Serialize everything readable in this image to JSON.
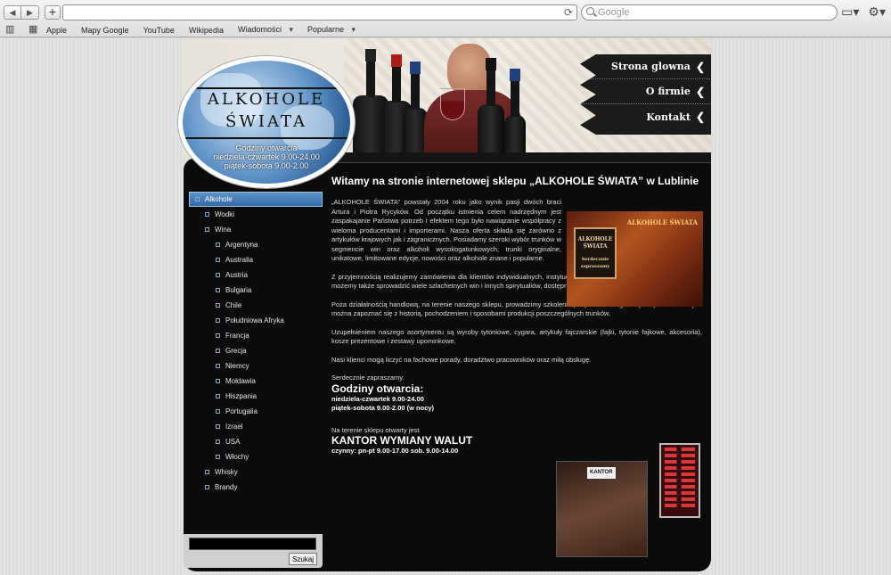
{
  "browser": {
    "back_glyph": "◀",
    "forward_glyph": "▶",
    "newtab_glyph": "+",
    "reload_glyph": "⟳",
    "search_placeholder": "Google",
    "bookmarks": [
      {
        "label": "Apple"
      },
      {
        "label": "Mapy Google"
      },
      {
        "label": "YouTube"
      },
      {
        "label": "Wikipedia"
      },
      {
        "label": "Wiadomości"
      },
      {
        "label": "Popularne"
      }
    ]
  },
  "header": {
    "logo_line1": "ALKOHOLE",
    "logo_line2": "ŚWIATA",
    "hours_title": "Godziny otwarcia",
    "hours_line1": "niedziela-czwartek 9.00-24.00",
    "hours_line2": "piątek-sobota 9.00-2.00"
  },
  "menu": [
    {
      "label": "Strona glowna"
    },
    {
      "label": "O firmie"
    },
    {
      "label": "Kontakt"
    }
  ],
  "sidebar": {
    "items": [
      {
        "label": "Alkohole",
        "level": 0,
        "active": true
      },
      {
        "label": "Wodki",
        "level": 1
      },
      {
        "label": "Wina",
        "level": 1
      },
      {
        "label": "Argentyna",
        "level": 2
      },
      {
        "label": "Australia",
        "level": 2
      },
      {
        "label": "Austria",
        "level": 2
      },
      {
        "label": "Bulgaria",
        "level": 2
      },
      {
        "label": "Chile",
        "level": 2
      },
      {
        "label": "Południowa Afryka",
        "level": 2
      },
      {
        "label": "Francja",
        "level": 2
      },
      {
        "label": "Grecja",
        "level": 2
      },
      {
        "label": "Niemcy",
        "level": 2
      },
      {
        "label": "Mołdawia",
        "level": 2
      },
      {
        "label": "Hiszpania",
        "level": 2
      },
      {
        "label": "Portugalia",
        "level": 2
      },
      {
        "label": "Izrael",
        "level": 2
      },
      {
        "label": "USA",
        "level": 2
      },
      {
        "label": "Włochy",
        "level": 2
      },
      {
        "label": "Whisky",
        "level": 1
      },
      {
        "label": "Brandy",
        "level": 1
      }
    ],
    "search_button": "Szukaj"
  },
  "content": {
    "heading": "Witamy na stronie internetowej sklepu „ALKOHOLE ŚWIATA” w Lublinie",
    "p1": "„ALKOHOLE ŚWIATA” powstały 2004 roku jako wynik pasji dwóch braci Artura i Piotra Rycyków. Od początku istnienia celem nadrzędnym jest zaspakajanie Państwa potrzeb i efektem tego było nawiązanie współpracy z wieloma producentami i importerami. Nasza oferta składa się zarówno z artykułów krajowych jak i zagranicznych. Posiadamy szeroki wybór trunków w segmencie win oraz alkoholi wysokogatunkowych, trunki oryginalne, unikatowe, limitowane edycje, nowości oraz alkohole znane i popularne.",
    "p2": "Z przyjemnością realizujemy zamówienia dla klientów indywidualnych, instytucjonalnych i dla firm. Specjalnie dla Państwa możemy także sprowadzić wiele szlachetnych win i innych spirytualiów, dostępnych wyłącznie na zamówienie.",
    "p3": "Poza działalnością handlową, na terenie naszego sklepu, prowadzimy szkolenia połączone z degustacjami podczas których można zapoznać się z historią, pochodzeniem i sposobami produkcji poszczególnych trunków.",
    "p4": "Uzupełnieniem naszego asortymentu są wyroby tytoniowe, cygara, artykuły fajczarskie (fajki, tytonie fajkowe, akcesoria), kosze prezentowe i zestawy upominkowe.",
    "p5": "Nasi klienci mogą liczyć na fachowe porady, doradztwo pracowników oraz miłą obsługę.",
    "invite": "Serdecznie zapraszamy.",
    "hours_title": "Godziny otwarcia:",
    "hours_line1": "niedziela-czwartek 9.00-24.00",
    "hours_line2": "piątek-sobota 9.00-2.00 (w nocy)",
    "kantor_intro": "Na terenie sklepu otwarty jest",
    "kantor_title": "KANTOR WYMIANY WALUT",
    "kantor_hours": "czynny: pn-pt 9.00-17.00 sob. 9.00-14.00",
    "shop_sign_line1": "ALKOHOLE",
    "shop_sign_line2": "ŚWIATA",
    "shop_sign_line3": "Serdecznie zapraszamy",
    "shop_top_sign": "ALKOHOLE ŚWIATA",
    "kantor_sign": "KANTOR"
  }
}
